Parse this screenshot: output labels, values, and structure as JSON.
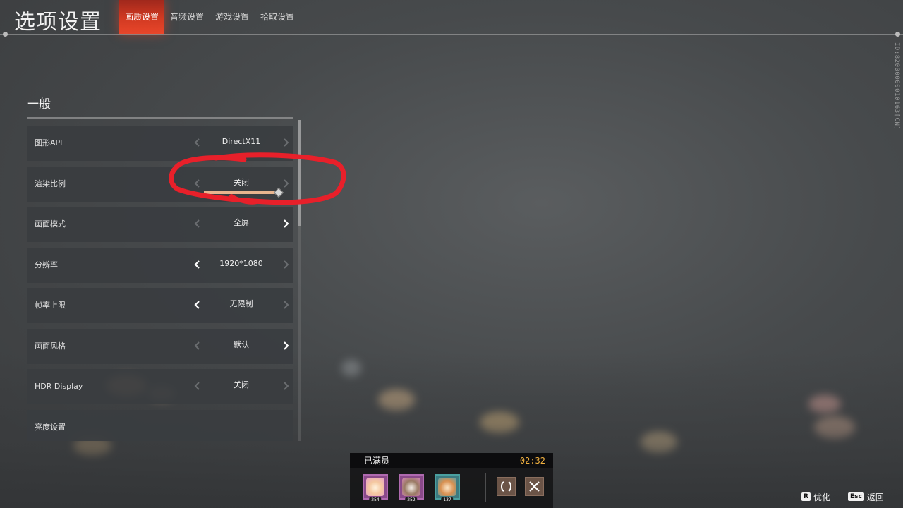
{
  "header": {
    "title": "选项设置",
    "tabs": [
      {
        "label": "画质设置",
        "active": true
      },
      {
        "label": "音频设置",
        "active": false
      },
      {
        "label": "游戏设置",
        "active": false
      },
      {
        "label": "拾取设置",
        "active": false
      }
    ]
  },
  "side_id": "ID:82000000010163[CN]",
  "section": {
    "title": "一般",
    "rows": [
      {
        "label": "图形API",
        "value": "DirectX11"
      },
      {
        "label": "渲染比例",
        "value": "关闭"
      },
      {
        "label": "画面模式",
        "value": "全屏"
      },
      {
        "label": "分辨率",
        "value": "1920*1080"
      },
      {
        "label": "帧率上限",
        "value": "无限制"
      },
      {
        "label": "画面风格",
        "value": "默认"
      },
      {
        "label": "HDR Display",
        "value": "关闭"
      },
      {
        "label": "亮度设置",
        "value": ""
      }
    ],
    "render_scale_slider": {
      "fraction": 1.0
    }
  },
  "team": {
    "status": "已满员",
    "timer": "02:32",
    "members": [
      {
        "level": "254"
      },
      {
        "level": "252"
      },
      {
        "level": "137"
      }
    ]
  },
  "hints": {
    "optimize_key": "R",
    "optimize_label": "优化",
    "back_key": "Esc",
    "back_label": "返回"
  },
  "colors": {
    "accent": "#e8462a",
    "timer": "#f0b040",
    "slider": "#e8b48e",
    "annotation": "#e8202a"
  }
}
